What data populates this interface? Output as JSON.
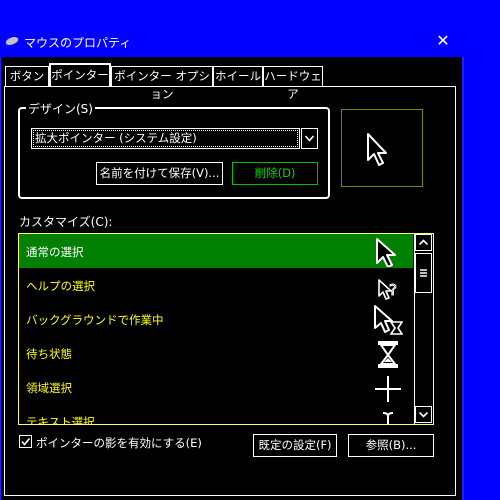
{
  "window": {
    "title": "マウスのプロパティ",
    "close_glyph": "✕"
  },
  "tabs": [
    {
      "label": "ボタン",
      "active": false
    },
    {
      "label": "ポインター",
      "active": true
    },
    {
      "label": "ポインター オプション",
      "active": false
    },
    {
      "label": "ホイール",
      "active": false
    },
    {
      "label": "ハードウェア",
      "active": false
    }
  ],
  "design": {
    "group_label": "デザイン(S)",
    "scheme_value": "拡大ポインター (システム設定)",
    "save_as_label": "名前を付けて保存(V)...",
    "delete_label": "削除(D)"
  },
  "customize": {
    "label": "カスタマイズ(C):",
    "rows": [
      {
        "label": "通常の選択",
        "icon": "arrow-cursor-icon",
        "selected": true
      },
      {
        "label": "ヘルプの選択",
        "icon": "help-cursor-icon",
        "selected": false
      },
      {
        "label": "バックグラウンドで作業中",
        "icon": "working-in-background-cursor-icon",
        "selected": false
      },
      {
        "label": "待ち状態",
        "icon": "busy-hourglass-cursor-icon",
        "selected": false
      },
      {
        "label": "領域選択",
        "icon": "precision-crosshair-cursor-icon",
        "selected": false
      },
      {
        "label": "テキスト選択",
        "icon": "text-beam-cursor-icon",
        "selected": false
      }
    ]
  },
  "shadow_checkbox": {
    "label": "ポインターの影を有効にする(E)",
    "checked": true
  },
  "default_label": "既定の設定(F)",
  "browse_label": "参照(B)...",
  "colors": {
    "titlebar": "#0000ff",
    "selection": "#008000",
    "list_text": "#ffff00",
    "delete_text": "#00e000"
  }
}
